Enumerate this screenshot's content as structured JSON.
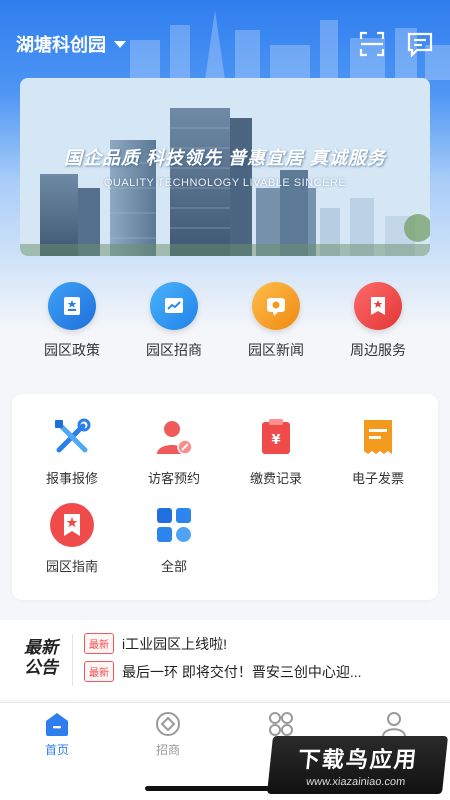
{
  "header": {
    "park_name": "湖塘科创园",
    "scan_icon": "scan-icon",
    "message_icon": "message-icon"
  },
  "banner": {
    "slogan": "国企品质  科技领先  普惠宜居  真诚服务",
    "subtitle": "QUALITY TECHNOLOGY LIVABLE SINCERE"
  },
  "quick_links": [
    {
      "label": "园区政策",
      "icon": "policy-icon",
      "color": "#2b8be8"
    },
    {
      "label": "园区招商",
      "icon": "chart-icon",
      "color": "#2c98f0"
    },
    {
      "label": "园区新闻",
      "icon": "news-icon",
      "color": "#f39a1e"
    },
    {
      "label": "周边服务",
      "icon": "star-icon",
      "color": "#ee4747"
    }
  ],
  "services": [
    {
      "label": "报事报修",
      "icon": "repair-tools-icon"
    },
    {
      "label": "访客预约",
      "icon": "visitor-icon"
    },
    {
      "label": "缴费记录",
      "icon": "payment-icon"
    },
    {
      "label": "电子发票",
      "icon": "invoice-icon"
    },
    {
      "label": "园区指南",
      "icon": "guide-icon"
    },
    {
      "label": "全部",
      "icon": "all-grid-icon"
    }
  ],
  "notice": {
    "logo_line1": "最新",
    "logo_line2": "公告",
    "items": [
      {
        "badge": "最新",
        "text": "i工业园区上线啦!"
      },
      {
        "badge": "最新",
        "text": "最后一环 即将交付！晋安三创中心迎..."
      }
    ]
  },
  "tabs": [
    {
      "label": "首页",
      "icon": "home-icon",
      "active": true
    },
    {
      "label": "招商",
      "icon": "investment-icon",
      "active": false
    },
    {
      "label": "",
      "icon": "apps-icon",
      "active": false
    },
    {
      "label": "",
      "icon": "profile-icon",
      "active": false
    }
  ],
  "watermark": {
    "title": "下载鸟应用",
    "url": "www.xiazainiao.com"
  },
  "colors": {
    "primary": "#2f7ef0",
    "badge_red": "#ef4b4b"
  }
}
